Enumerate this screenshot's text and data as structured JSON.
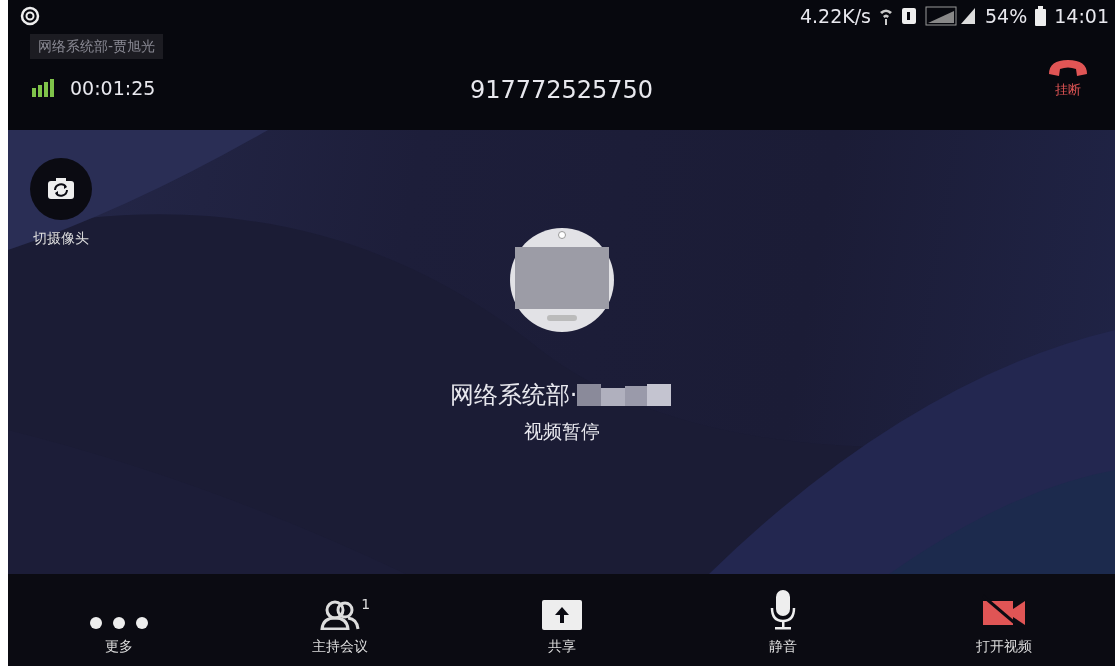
{
  "status_bar": {
    "speed": "4.22K/s",
    "battery": "54%",
    "time": "14:01"
  },
  "toast": "网络系统部-贾旭光",
  "call": {
    "duration": "00:01:25",
    "number": "917772525750",
    "hangup": "挂断"
  },
  "camera_switch": {
    "label": "切摄像头"
  },
  "participant": {
    "name": "网络系统部·",
    "status": "视频暂停"
  },
  "toolbar": [
    {
      "kind": "more",
      "label": "更多"
    },
    {
      "kind": "host",
      "label": "主持会议",
      "badge": "1"
    },
    {
      "kind": "share",
      "label": "共享"
    },
    {
      "kind": "mute",
      "label": "静音"
    },
    {
      "kind": "video",
      "label": "打开视频",
      "on": false
    }
  ]
}
